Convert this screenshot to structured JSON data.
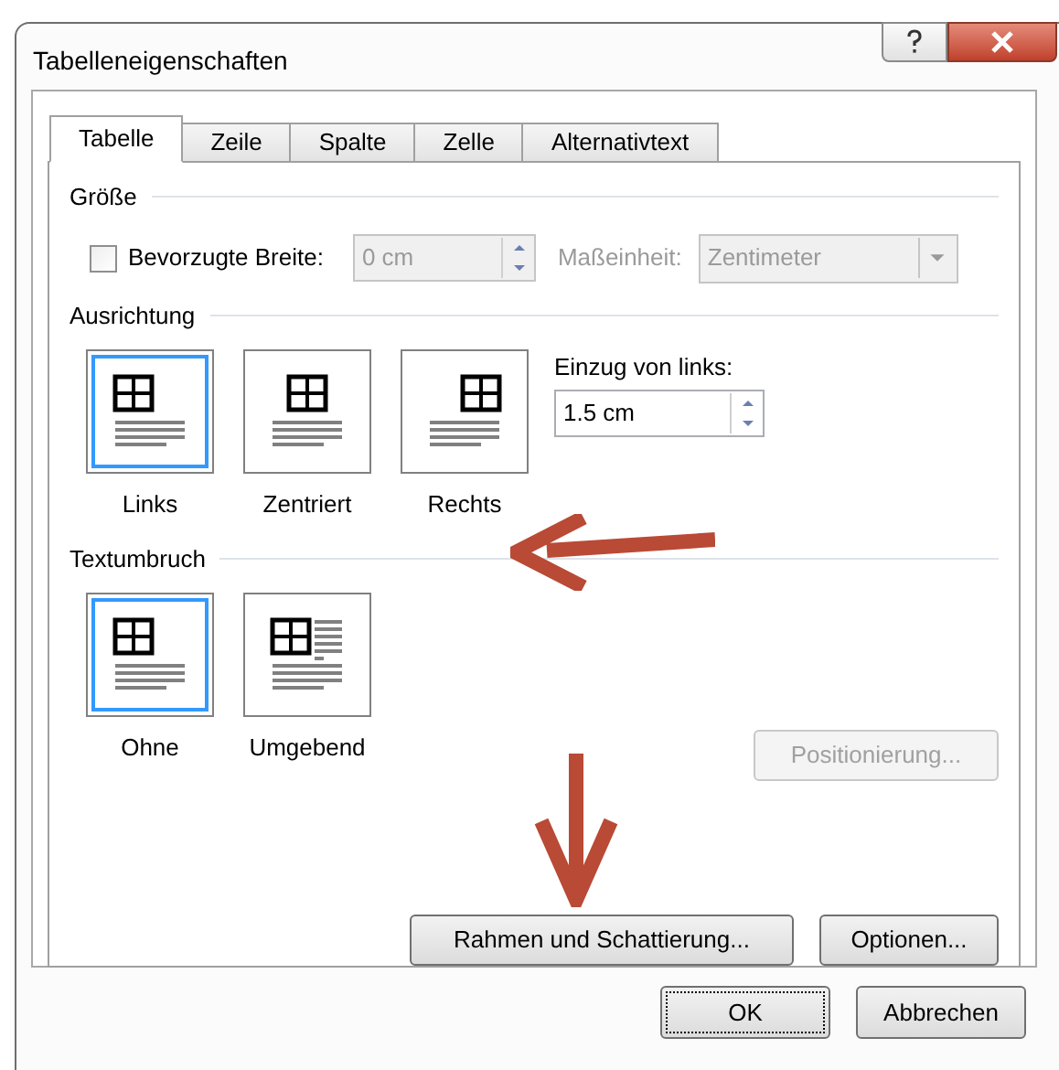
{
  "window": {
    "title": "Tabelleneigenschaften"
  },
  "tabs": [
    {
      "label": "Tabelle",
      "selected": true
    },
    {
      "label": "Zeile",
      "selected": false
    },
    {
      "label": "Spalte",
      "selected": false
    },
    {
      "label": "Zelle",
      "selected": false
    },
    {
      "label": "Alternativtext",
      "selected": false
    }
  ],
  "size": {
    "title": "Größe",
    "preferred_width": {
      "label": "Bevorzugte Breite:",
      "checked": false
    },
    "width_field": {
      "value": "0 cm",
      "disabled": true
    },
    "unit_label": "Maßeinheit:",
    "unit_select": {
      "value": "Zentimeter",
      "disabled": true
    }
  },
  "alignment": {
    "title": "Ausrichtung",
    "options": [
      {
        "label": "Links",
        "kind": "left",
        "selected": true
      },
      {
        "label": "Zentriert",
        "kind": "center",
        "selected": false
      },
      {
        "label": "Rechts",
        "kind": "right",
        "selected": false
      }
    ],
    "indent_label": "Einzug von links:",
    "indent_value": "1.5 cm"
  },
  "wrapping": {
    "title": "Textumbruch",
    "options": [
      {
        "label": "Ohne",
        "kind": "none",
        "selected": true
      },
      {
        "label": "Umgebend",
        "kind": "around",
        "selected": false
      }
    ],
    "positioning_button": {
      "label": "Positionierung...",
      "disabled": true
    }
  },
  "panel_buttons": [
    "Rahmen und Schattierung...",
    "Optionen..."
  ],
  "footer_buttons": [
    {
      "label": "OK",
      "default": true
    },
    {
      "label": "Abbrechen",
      "default": false
    }
  ]
}
